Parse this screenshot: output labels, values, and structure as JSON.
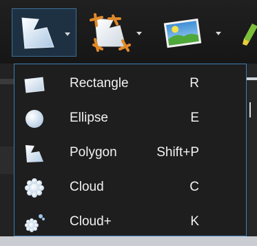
{
  "toolbar": {
    "buttons": [
      {
        "name": "polygon-shape-tool",
        "icon": "polygon-shape-icon",
        "active": true
      },
      {
        "name": "crop-tool",
        "icon": "crop-icon",
        "active": false
      },
      {
        "name": "image-tool",
        "icon": "landscape-image-icon",
        "active": false
      },
      {
        "name": "highlighter-tool",
        "icon": "highlighter-icon",
        "active": false
      }
    ],
    "active_border_color": "#3d6f96"
  },
  "menu": {
    "border_color": "#3d7fb8",
    "items": [
      {
        "label": "Rectangle",
        "shortcut": "R",
        "icon": "rectangle-shape-icon"
      },
      {
        "label": "Ellipse",
        "shortcut": "E",
        "icon": "ellipse-shape-icon"
      },
      {
        "label": "Polygon",
        "shortcut": "Shift+P",
        "icon": "polygon-shape-icon"
      },
      {
        "label": "Cloud",
        "shortcut": "C",
        "icon": "cloud-shape-icon"
      },
      {
        "label": "Cloud+",
        "shortcut": "K",
        "icon": "cloud-plus-shape-icon"
      }
    ]
  }
}
